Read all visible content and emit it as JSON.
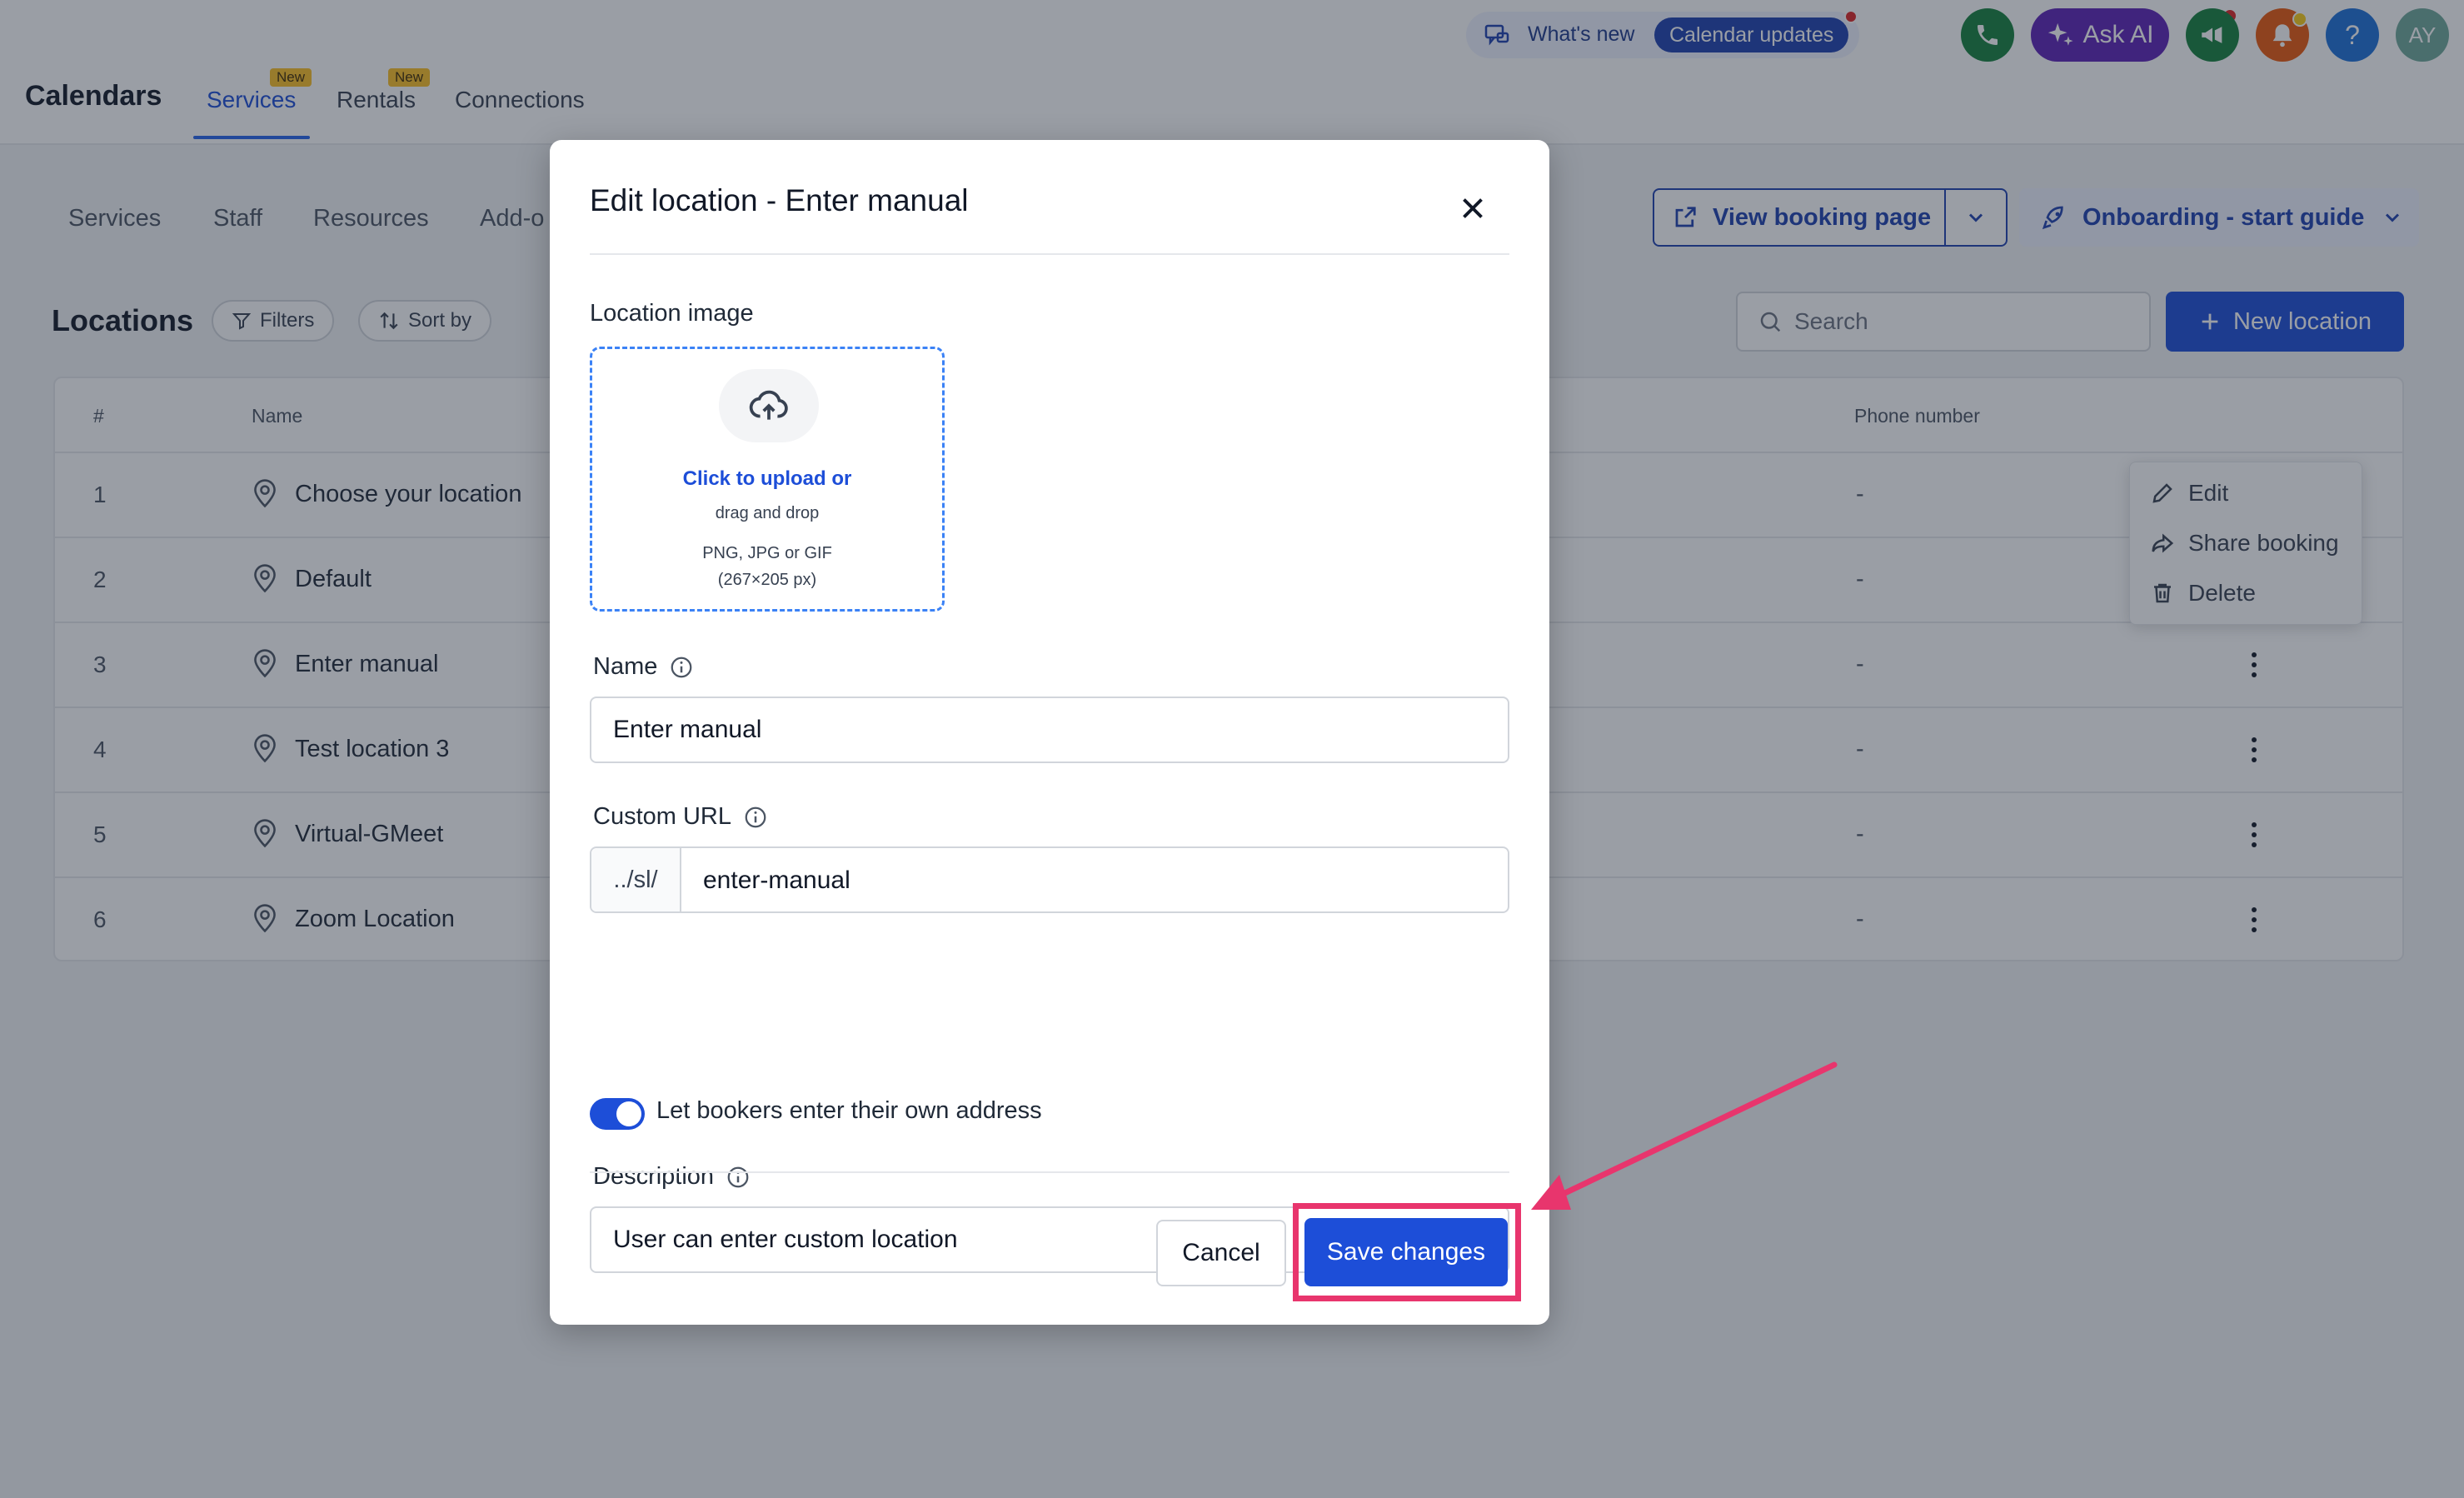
{
  "app": {
    "title": "Calendars",
    "tabs": [
      {
        "label": "Services",
        "badge": "New",
        "active": true
      },
      {
        "label": "Rentals",
        "badge": "New",
        "active": false
      },
      {
        "label": "Connections",
        "badge": "",
        "active": false
      }
    ]
  },
  "header": {
    "whats_new_label": "What's new",
    "calendar_updates_label": "Calendar updates",
    "ask_ai_label": "Ask AI",
    "help_label": "?",
    "avatar_initials": "AY",
    "colors": {
      "phone": "#15803d",
      "ask_ai": "#5b21b6",
      "megaphone": "#15803d",
      "notifications": "#ea580c",
      "help": "#1d6fd8",
      "avatar": "#6ea89a"
    }
  },
  "subnav": {
    "items": [
      "Services",
      "Staff",
      "Resources",
      "Add-o"
    ],
    "view_booking_label": "View booking page",
    "onboarding_label": "Onboarding - start guide"
  },
  "locations": {
    "title": "Locations",
    "filters_label": "Filters",
    "sort_label": "Sort by",
    "search_placeholder": "Search",
    "new_location_label": "New location",
    "columns": {
      "number": "#",
      "name": "Name",
      "phone": "Phone number"
    },
    "rows": [
      {
        "num": "1",
        "name": "Choose your location",
        "phone": "-"
      },
      {
        "num": "2",
        "name": "Default",
        "phone": "-"
      },
      {
        "num": "3",
        "name": "Enter manual",
        "phone": "-"
      },
      {
        "num": "4",
        "name": "Test location 3",
        "phone": "-"
      },
      {
        "num": "5",
        "name": "Virtual-GMeet",
        "phone": "-"
      },
      {
        "num": "6",
        "name": "Zoom Location",
        "phone": "-"
      }
    ],
    "context_menu": [
      "Edit",
      "Share booking",
      "Delete"
    ]
  },
  "modal": {
    "title": "Edit location - Enter manual",
    "image_label": "Location image",
    "upload_main": "Click to upload or",
    "upload_drag": "drag and drop",
    "upload_formats": "PNG, JPG or GIF",
    "upload_size": "(267×205 px)",
    "name_label": "Name",
    "name_value": "Enter manual",
    "url_label": "Custom URL",
    "url_prefix": "../sl/",
    "url_value": "enter-manual",
    "toggle_label": "Let bookers enter their own address",
    "toggle_on": true,
    "description_label": "Description",
    "description_value": "User can enter custom location",
    "cancel_label": "Cancel",
    "save_label": "Save changes"
  },
  "annotation": {
    "color": "#e8356d"
  }
}
